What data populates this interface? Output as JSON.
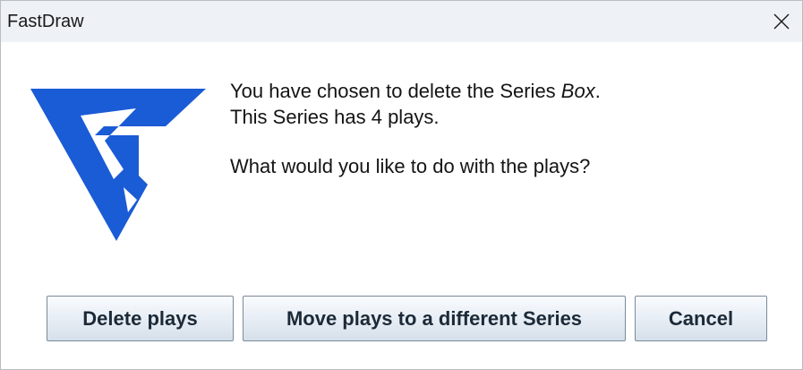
{
  "window": {
    "title": "FastDraw",
    "close_icon": "close-icon"
  },
  "logo": {
    "icon": "fastdraw-logo-icon",
    "color": "#1a5bd6"
  },
  "message": {
    "line1_prefix": "You have chosen to delete the Series ",
    "series_name": "Box",
    "line1_suffix": ".",
    "line2": "This Series has 4 plays.",
    "line3": "What would you like to do with the plays?"
  },
  "buttons": {
    "delete": "Delete plays",
    "move": "Move plays to a different Series",
    "cancel": "Cancel"
  }
}
